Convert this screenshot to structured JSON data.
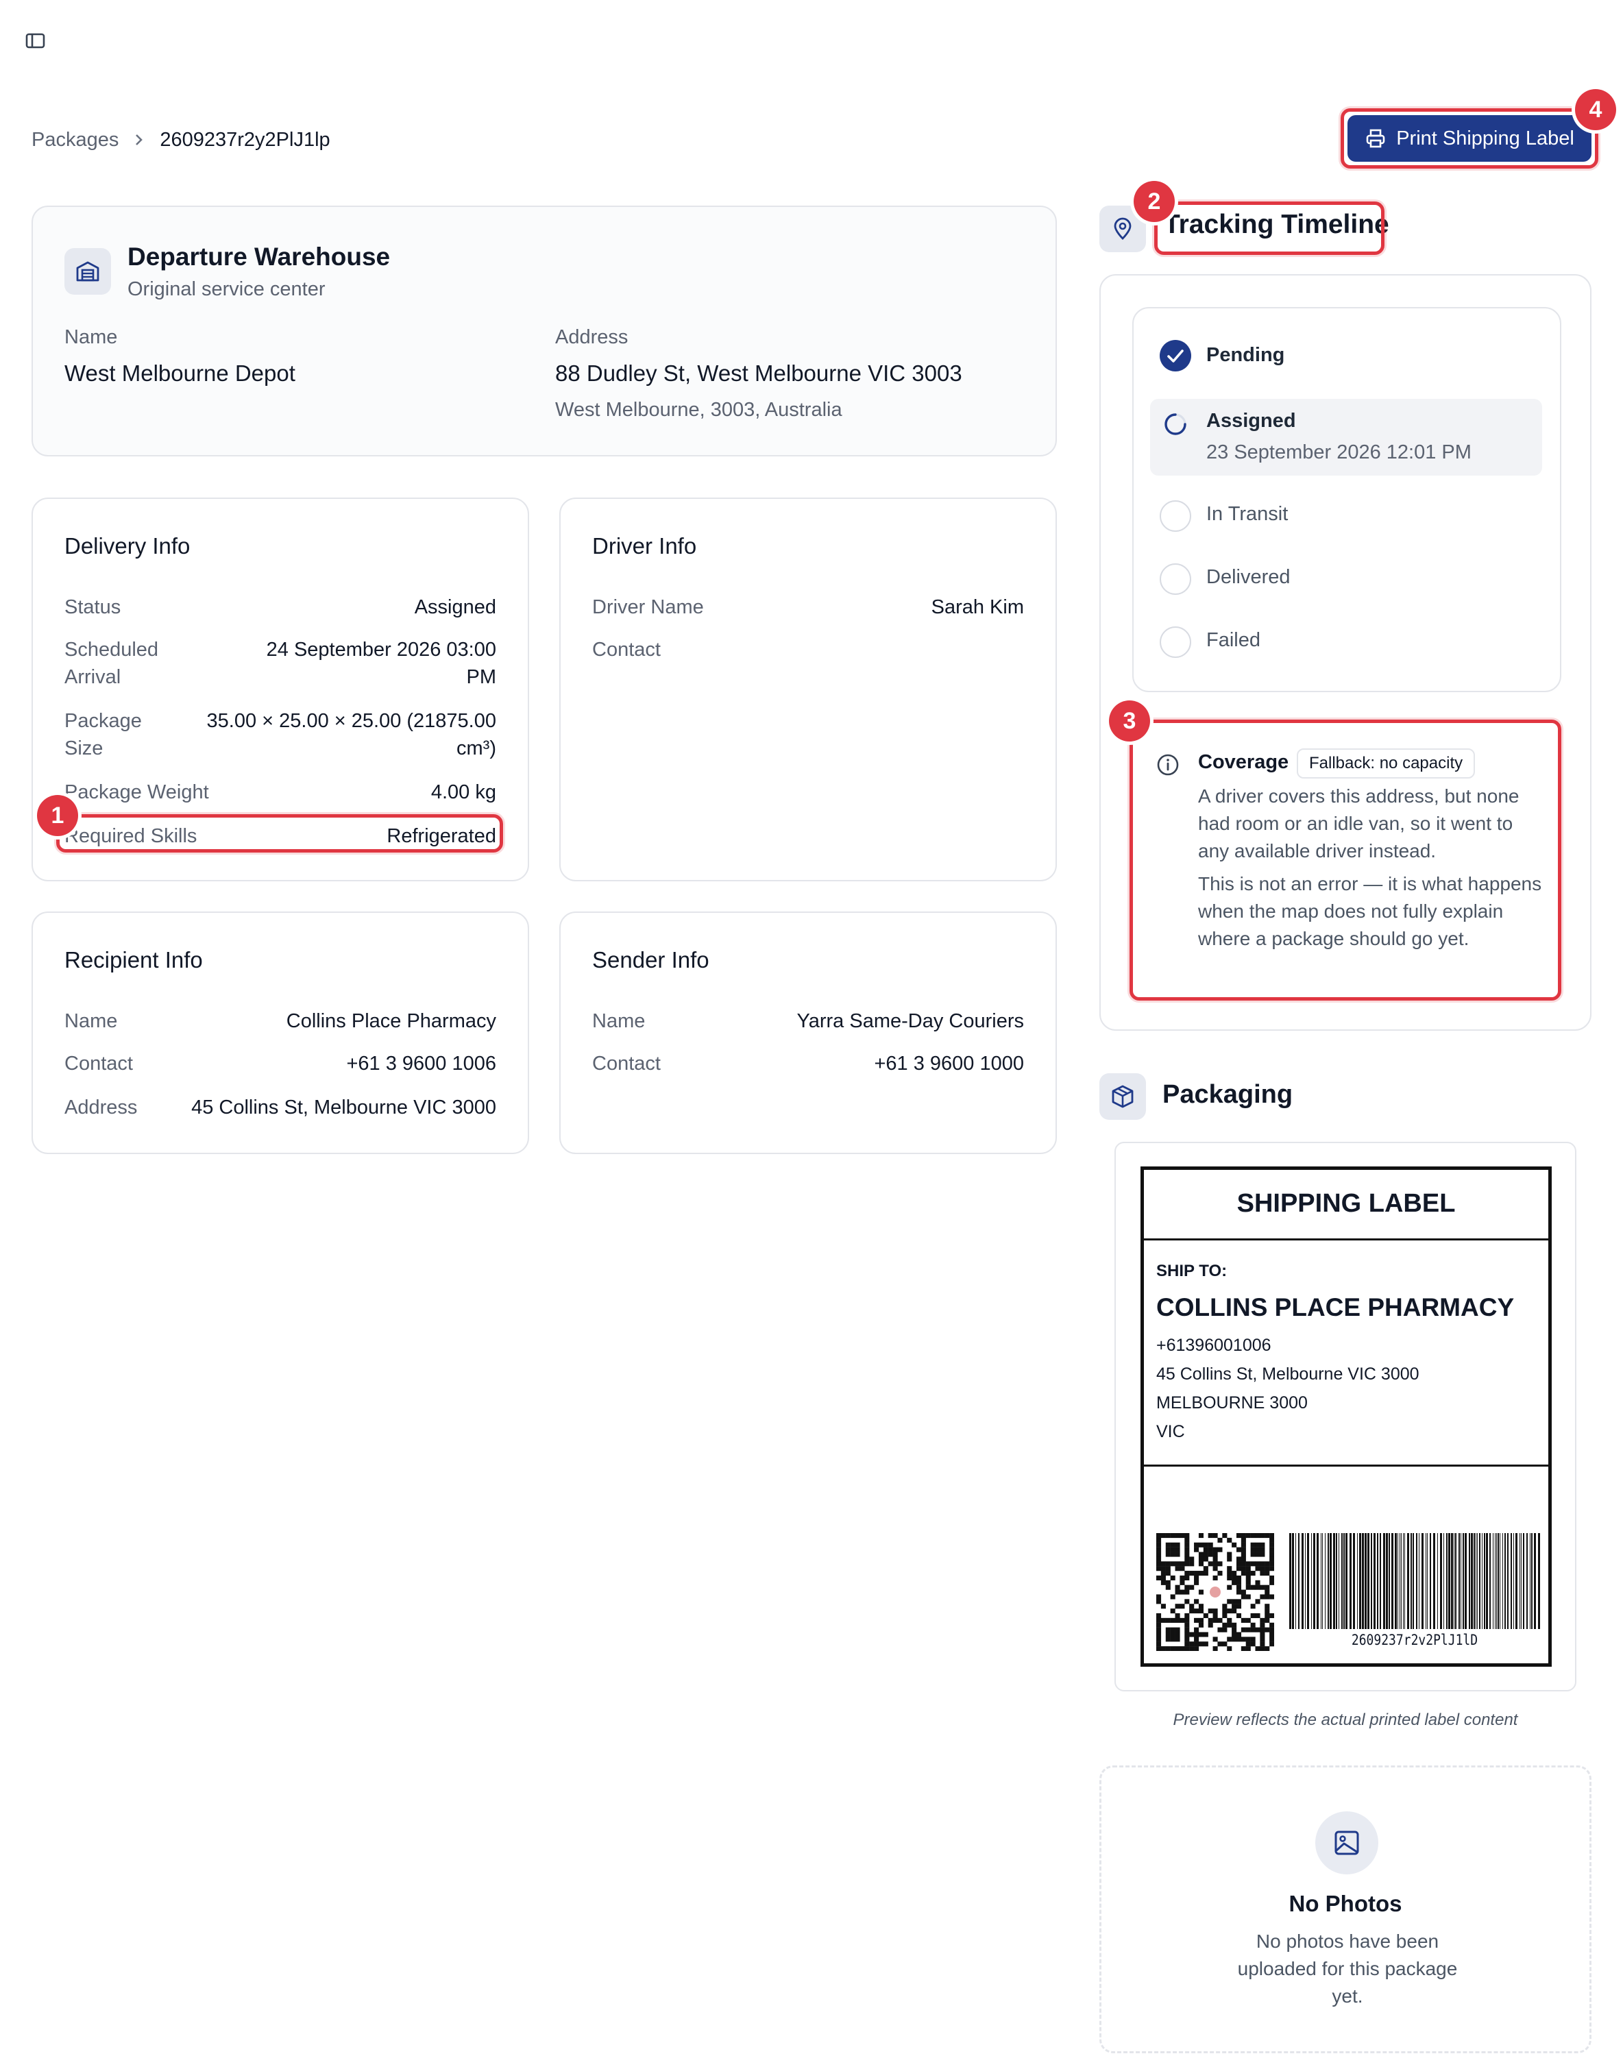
{
  "sidebar_toggle_icon": "sidebar-toggle-icon",
  "breadcrumb": {
    "parent": "Packages",
    "current": "2609237r2y2PlJ1lp"
  },
  "print_button": {
    "label": "Print Shipping Label",
    "icon": "printer-icon",
    "color": "#1f3a8a"
  },
  "departure": {
    "title": "Departure Warehouse",
    "subtitle": "Original service center",
    "name_label": "Name",
    "name_value": "West Melbourne Depot",
    "address_label": "Address",
    "address_line1": "88 Dudley St, West Melbourne VIC 3003",
    "address_line2": "West Melbourne, 3003, Australia"
  },
  "delivery": {
    "title": "Delivery Info",
    "rows": [
      {
        "label": "Status",
        "value": "Assigned"
      },
      {
        "label": "Scheduled Arrival",
        "value": "24 September 2026 03:00 PM"
      },
      {
        "label": "Package Size",
        "value": "35.00 × 25.00 × 25.00 (21875.00 cm³)"
      },
      {
        "label": "Package Weight",
        "value": "4.00 kg"
      },
      {
        "label": "Required Skills",
        "value": "Refrigerated"
      }
    ]
  },
  "driver": {
    "title": "Driver Info",
    "rows": [
      {
        "label": "Driver Name",
        "value": "Sarah Kim"
      },
      {
        "label": "Contact",
        "value": ""
      }
    ]
  },
  "recipient": {
    "title": "Recipient Info",
    "rows": [
      {
        "label": "Name",
        "value": "Collins Place Pharmacy"
      },
      {
        "label": "Contact",
        "value": "+61 3 9600 1006"
      },
      {
        "label": "Address",
        "value": "45 Collins St, Melbourne VIC 3000"
      }
    ]
  },
  "sender": {
    "title": "Sender Info",
    "rows": [
      {
        "label": "Name",
        "value": "Yarra Same-Day Couriers"
      },
      {
        "label": "Contact",
        "value": "+61 3 9600 1000"
      }
    ]
  },
  "tracking": {
    "title": "Tracking Timeline",
    "steps": [
      {
        "label": "Pending",
        "state": "done"
      },
      {
        "label": "Assigned",
        "state": "current",
        "date": "23 September 2026 12:01 PM"
      },
      {
        "label": "In Transit",
        "state": "upcoming"
      },
      {
        "label": "Delivered",
        "state": "upcoming"
      },
      {
        "label": "Failed",
        "state": "upcoming"
      }
    ]
  },
  "coverage": {
    "title": "Coverage",
    "tag": "Fallback: no capacity",
    "text1": "A driver covers this address, but none had room or an idle van, so it went to any available driver instead.",
    "text2": "This is not an error — it is what happens when the map does not fully explain where a package should go yet."
  },
  "packaging": {
    "title": "Packaging",
    "label": {
      "heading": "SHIPPING LABEL",
      "ship_to": "SHIP TO:",
      "name": "COLLINS PLACE PHARMACY",
      "phone": "+61396001006",
      "address": "45 Collins St, Melbourne VIC 3000",
      "city": "MELBOURNE 3000",
      "state": "VIC",
      "barcode_text": "2609237r2v2PlJ1lD"
    },
    "caption": "Preview reflects the actual printed label content"
  },
  "photos": {
    "title": "No Photos",
    "text": "No photos have been uploaded for this package yet."
  },
  "annotations": [
    "1",
    "2",
    "3",
    "4"
  ],
  "colors": {
    "accent": "#1f3a8a",
    "annotation": "#e03641",
    "border": "#e3e5ea"
  }
}
